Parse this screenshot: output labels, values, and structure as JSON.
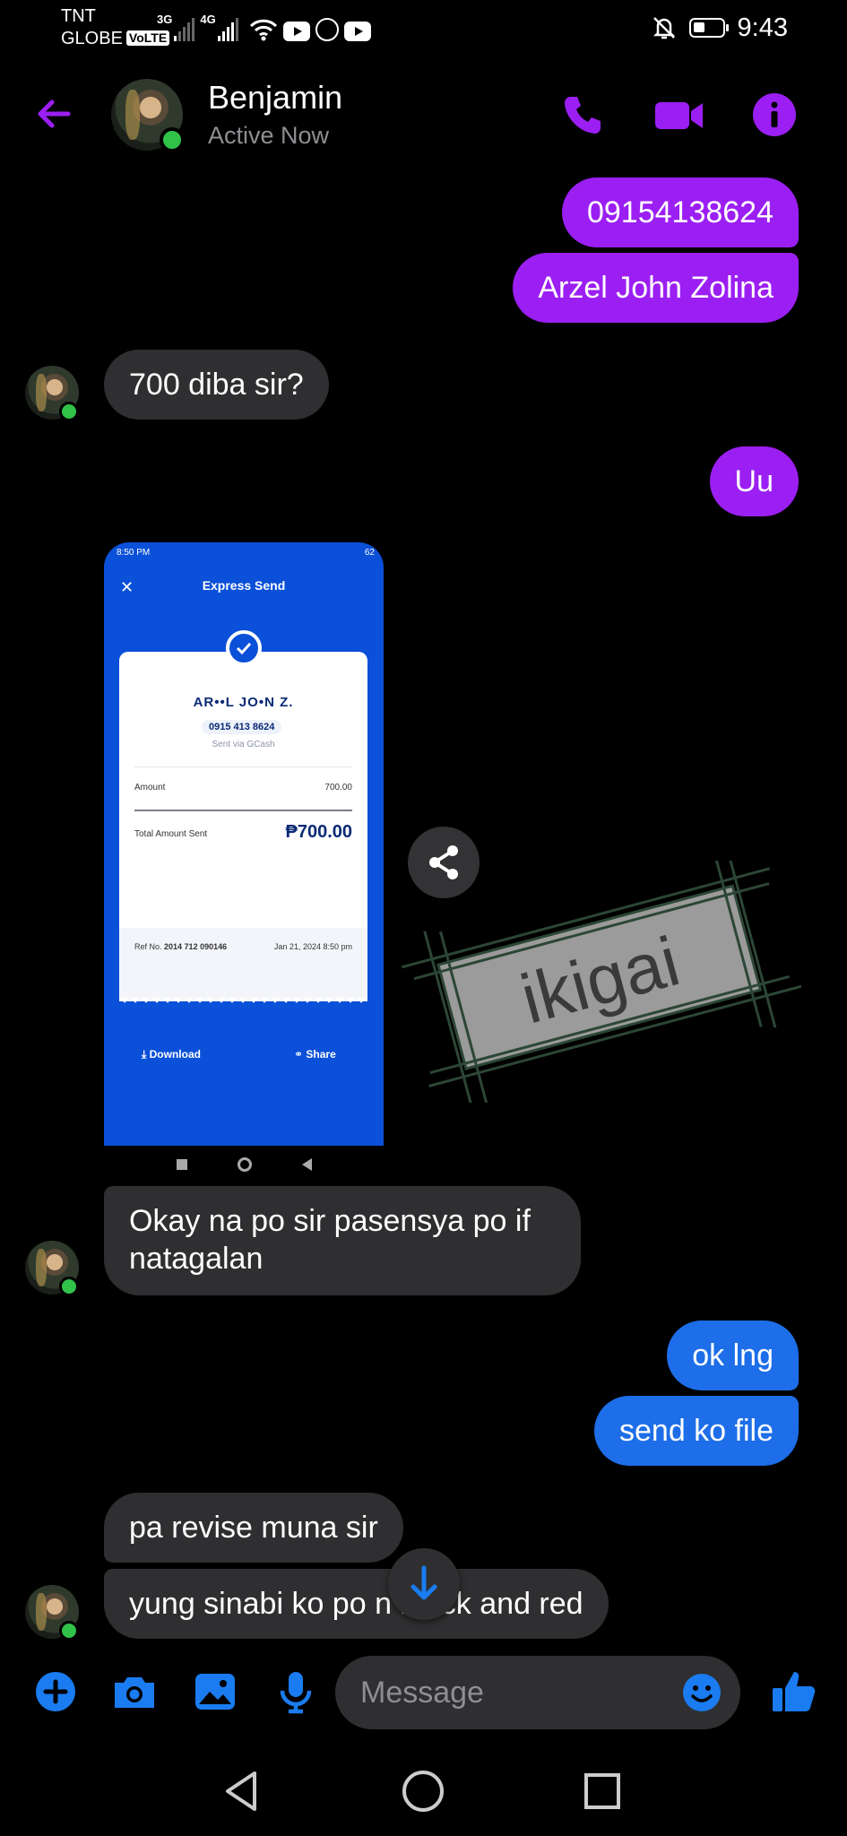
{
  "status_bar": {
    "carrier_top": "TNT",
    "carrier_bottom": "GLOBE",
    "volte": "VoLTE",
    "net1": "3G",
    "net2": "4G",
    "time": "9:43"
  },
  "header": {
    "contact_name": "Benjamin",
    "contact_status": "Active Now"
  },
  "messages": {
    "m1": "09154138624",
    "m2": "Arzel John Zolina",
    "m3": "700 diba sir?",
    "m4": "Uu",
    "m5_line1": "Okay na po sir pasensya po if",
    "m5_line2": "natagalan",
    "m6": "ok lng",
    "m7": "send ko file",
    "m8": "pa revise muna sir",
    "m9": "yung sinabi ko po n black and red"
  },
  "screenshot": {
    "status_time": "8:50 PM",
    "status_battery": "62",
    "title": "Express Send",
    "recipient": "AR••L JO•N Z.",
    "number": "0915 413 8624",
    "via": "Sent via GCash",
    "amount_label": "Amount",
    "amount_value": "700.00",
    "total_label": "Total Amount Sent",
    "total_value": "₱700.00",
    "ref_label": "Ref No.",
    "ref_value": "2014 712 090146",
    "date": "Jan 21, 2024 8:50 pm",
    "download": "Download",
    "share": "Share"
  },
  "sticker": {
    "text": "ikigai"
  },
  "composer": {
    "placeholder": "Message"
  },
  "colors": {
    "accent": "#9b1ff3",
    "sent_purple": "#9b1ff3",
    "sent_blue": "#1d6ee8",
    "received": "#2f2f31",
    "icon_blue": "#1a7cf0",
    "online": "#31c24a"
  },
  "icons": [
    "back-arrow-icon",
    "phone-icon",
    "video-icon",
    "info-icon",
    "share-icon",
    "arrow-down-icon",
    "plus-icon",
    "camera-icon",
    "gallery-icon",
    "mic-icon",
    "emoji-icon",
    "thumbs-up-icon"
  ]
}
